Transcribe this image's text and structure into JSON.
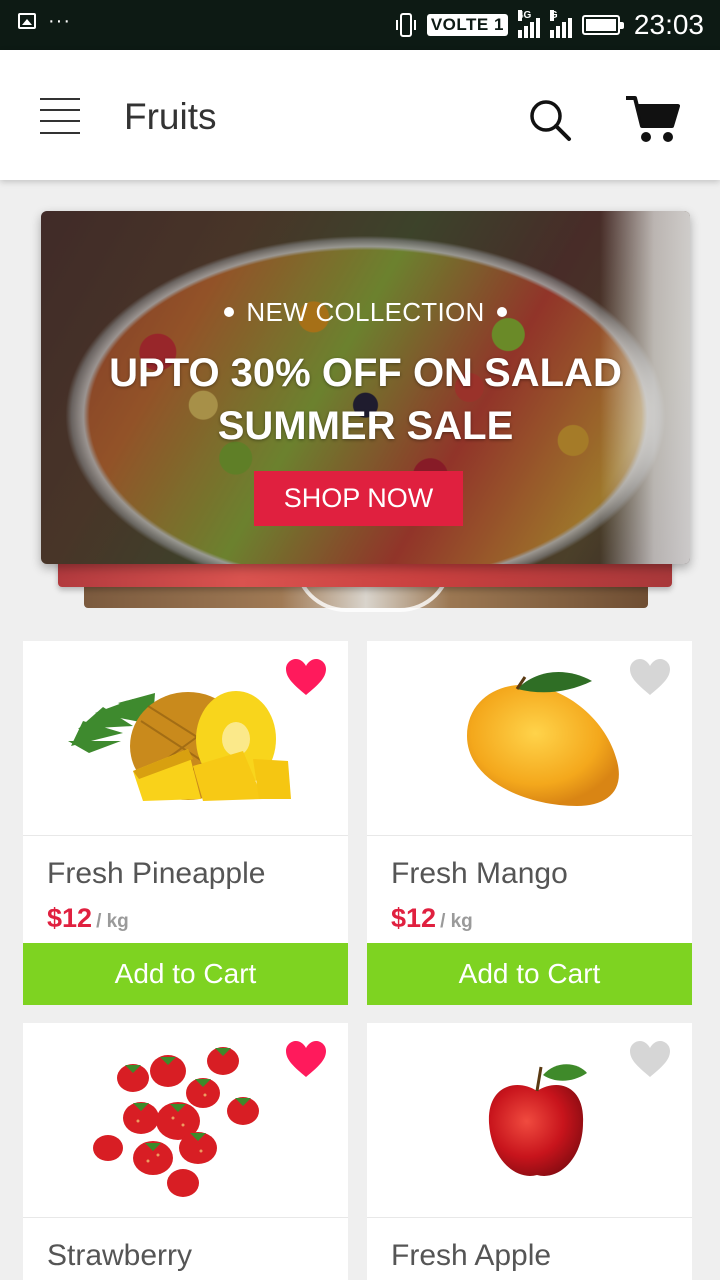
{
  "status_bar": {
    "network": "VOLTE 1",
    "sim1_type": "4G",
    "sim2_type": "G",
    "time": "23:03",
    "battery_level": 1.0
  },
  "app_bar": {
    "title": "Fruits",
    "icons": [
      "menu-icon",
      "search-icon",
      "cart-icon"
    ]
  },
  "banner": {
    "kicker": "NEW COLLECTION",
    "headline_line1": "UPTO 30% OFF ON SALAD",
    "headline_line2": "SUMMER SALE",
    "cta": "SHOP NOW",
    "cta_color": "#e0203f"
  },
  "products": [
    {
      "name": "Fresh Pineapple",
      "price": "$12",
      "unit": "/ kg",
      "favorite": true,
      "cta": "Add to Cart"
    },
    {
      "name": "Fresh Mango",
      "price": "$12",
      "unit": "/ kg",
      "favorite": false,
      "cta": "Add to Cart"
    },
    {
      "name": "Strawberry",
      "favorite": true
    },
    {
      "name": "Fresh Apple",
      "favorite": false
    }
  ],
  "colors": {
    "accent_green": "#7ed321",
    "price_red": "#e0203f",
    "heart_active": "#ff1a5c",
    "heart_inactive": "#d6d6d6"
  }
}
